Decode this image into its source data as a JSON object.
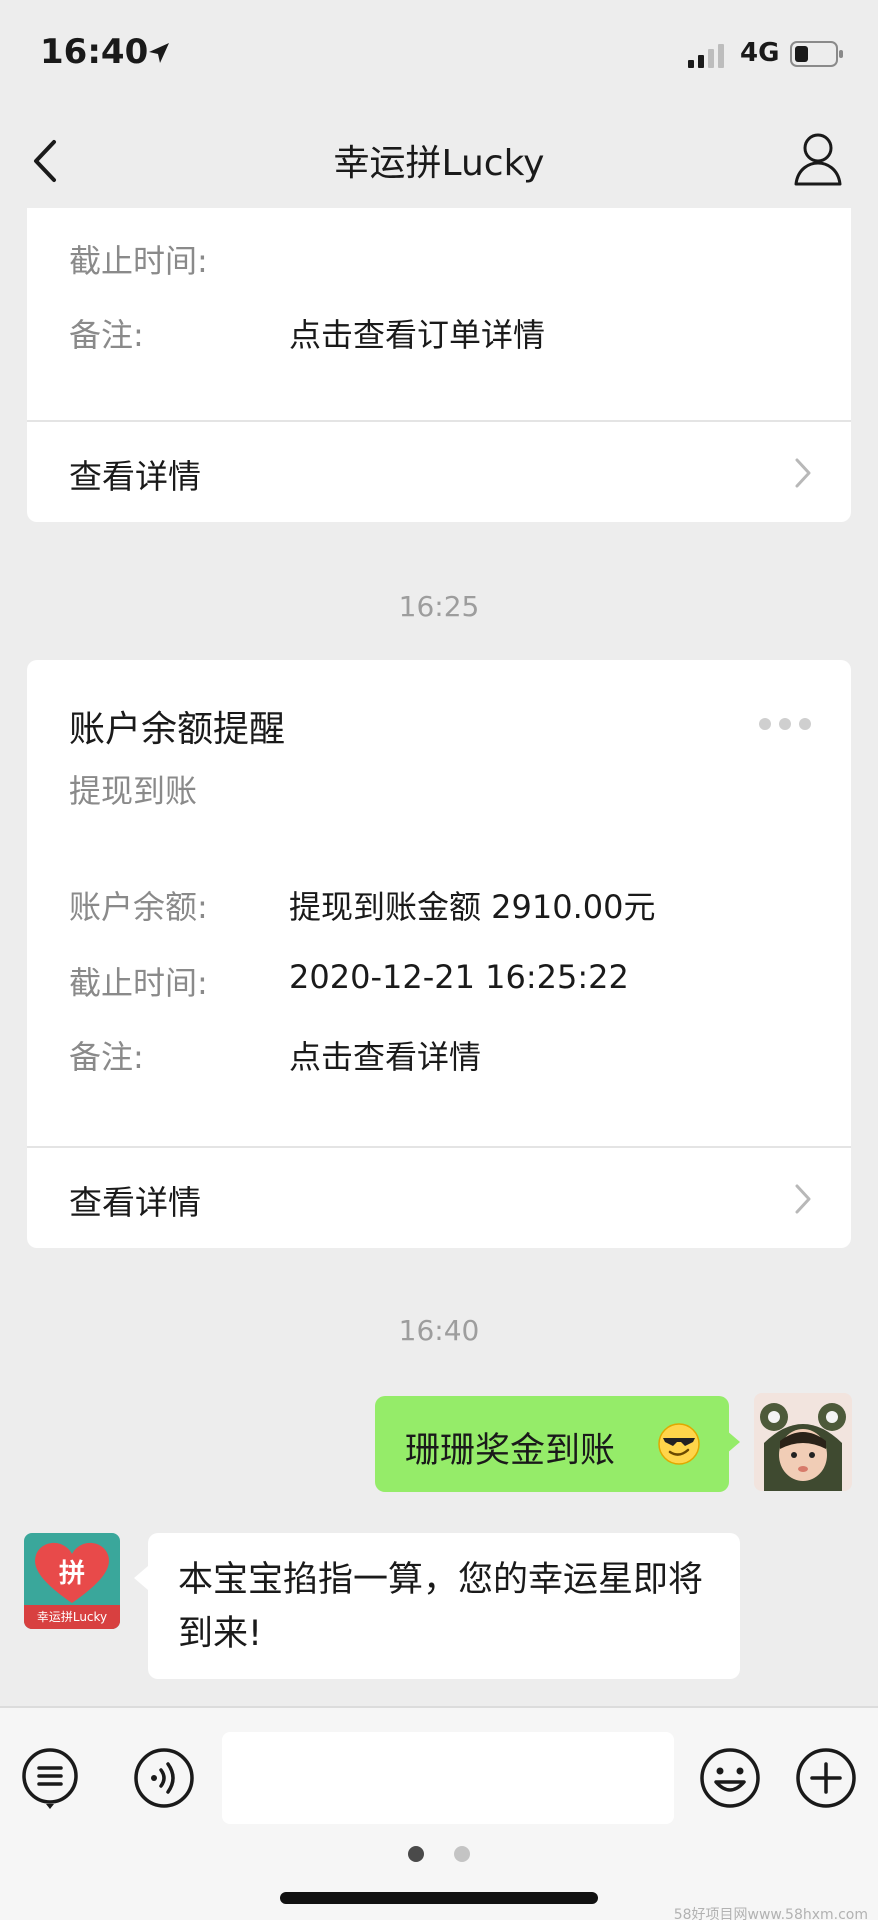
{
  "status_bar": {
    "time": "16:40",
    "network": "4G"
  },
  "nav": {
    "title": "幸运拼Lucky"
  },
  "card1": {
    "rows": [
      {
        "label": "截止时间:",
        "value": ""
      },
      {
        "label": "备注:",
        "value": "点击查看订单详情"
      }
    ],
    "footer": "查看详情"
  },
  "timestamp1": "16:25",
  "card2": {
    "title": "账户余额提醒",
    "subtitle": "提现到账",
    "rows": [
      {
        "label": "账户余额:",
        "value": "提现到账金额 2910.00元"
      },
      {
        "label": "截止时间:",
        "value": "2020-12-21 16:25:22"
      },
      {
        "label": "备注:",
        "value": "点击查看详情"
      }
    ],
    "footer": "查看详情"
  },
  "timestamp2": "16:40",
  "messages": {
    "outgoing": "珊珊奖金到账",
    "incoming": "本宝宝掐指一算，您的幸运星即将到来!"
  },
  "bot_avatar": {
    "char": "拼",
    "caption": "幸运拼Lucky"
  },
  "icons": {
    "back": "chevron-left-icon",
    "profile": "person-icon",
    "menu": "menu-list-icon",
    "voice": "voice-icon",
    "emoji": "emoji-icon",
    "plus": "plus-icon"
  },
  "watermark": "58好项目网www.58hxm.com"
}
